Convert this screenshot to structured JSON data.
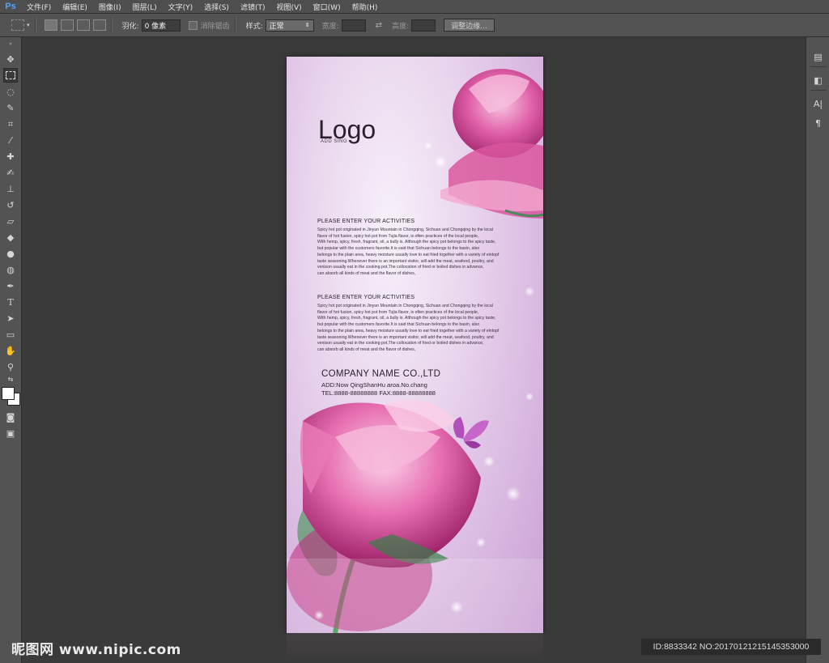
{
  "app": {
    "logo": "Ps"
  },
  "menu": [
    "文件(F)",
    "编辑(E)",
    "图像(I)",
    "图层(L)",
    "文字(Y)",
    "选择(S)",
    "滤镜(T)",
    "视图(V)",
    "窗口(W)",
    "帮助(H)"
  ],
  "options": {
    "feather_label": "羽化:",
    "feather_value": "0 像素",
    "antialias_label": "消除锯齿",
    "style_label": "样式:",
    "style_value": "正常",
    "width_label": "宽度:",
    "height_label": "高度:",
    "refine_button": "调整边缘..."
  },
  "colors": {
    "foreground": "#ffffff",
    "background": "#ffffff",
    "workspace": "#3a3a3a",
    "panel": "#535353"
  },
  "tools": [
    "move-tool",
    "marquee-tool",
    "lasso-tool",
    "quick-select-tool",
    "crop-tool",
    "eyedropper-tool",
    "healing-tool",
    "brush-tool",
    "stamp-tool",
    "history-brush-tool",
    "eraser-tool",
    "paint-bucket-tool",
    "blur-tool",
    "dodge-tool",
    "pen-tool",
    "type-tool",
    "path-select-tool",
    "shape-tool",
    "hand-tool",
    "zoom-tool"
  ],
  "poster": {
    "logo": "Logo",
    "logo_sub": "ADD SING",
    "section1_title": "PLEASE ENTER YOUR ACTIVITIES",
    "section1_lines": [
      "Spicy hot pot originated in Jinyun Mountain in Chongqing, Sichuan and Chongqing by the local",
      "flavor of hot fusion, spicy hot pot from Tujia flavor, is often practices of the local people,",
      "With hemp, spicy, fresh, fragrant, oil, a bully is. Although the spicy pot belongs to the spicy taste,",
      "but popular with the customers favorite.It is said that Sichuan belongs to the basin, also",
      "belongs to the plain area, heavy moisture usually love to eat fried together with a variety of eintopf",
      "taste seasoning.Whenever there is an important visitor, will add the meat, seafood, poultry, and",
      "venison usually eat in the cooking pot,The collocation of fried or boiled dishes in advance,",
      "can absorb all kinds of meat and the flavor of dishes,"
    ],
    "section2_title": "PLEASE ENTER YOUR ACTIVITIES",
    "section2_lines": [
      "Spicy hot pot originated in Jinyun Mountain in Chongqing, Sichuan and Chongqing by the local",
      "flavor of hot fusion, spicy hot pot from Tujia flavor, is often practices of the local people,",
      "With hemp, spicy, fresh, fragrant, oil, a bully is. Although the spicy pot belongs to the spicy taste,",
      "but popular with the customers favorite.It is said that Sichuan belongs to the basin, also",
      "belongs to the plain area, heavy moisture usually love to eat fried together with a variety of eintopf",
      "taste seasoning.Whenever there is an important visitor, will add the meat, seafood, poultry, and",
      "venison usually eat in the cooking pot,The collocation of fried or boiled dishes in advance,",
      "can absorb all kinds of meat and the flavor of dishes,"
    ],
    "company": "COMPANY NAME CO.,LTD",
    "address": "ADD:Now QingShanHu aroa.No.chang",
    "phone": "TEL:8888-88888888  FAX:8888-88888888"
  },
  "watermark": "昵图网 www.nipic.com",
  "image_id": "ID:8833342 NO:20170121215145353000"
}
